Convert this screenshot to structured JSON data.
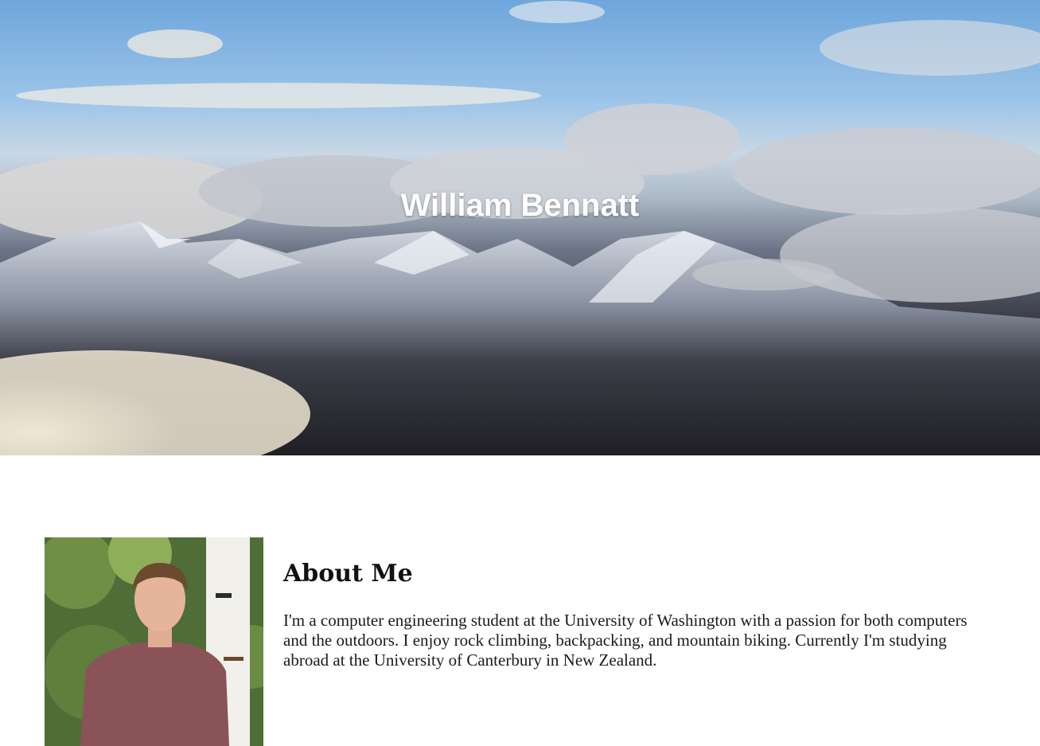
{
  "hero": {
    "title": "William Bennatt",
    "image": "mountain-clouds-photo"
  },
  "about": {
    "heading": "About Me",
    "body": "I'm a computer engineering student at the University of Washington with a passion for both computers and the outdoors. I enjoy rock climbing, backpacking, and mountain biking. Currently I'm studying abroad at the University of Canterbury in New Zealand.",
    "portrait": "portrait-photo"
  }
}
